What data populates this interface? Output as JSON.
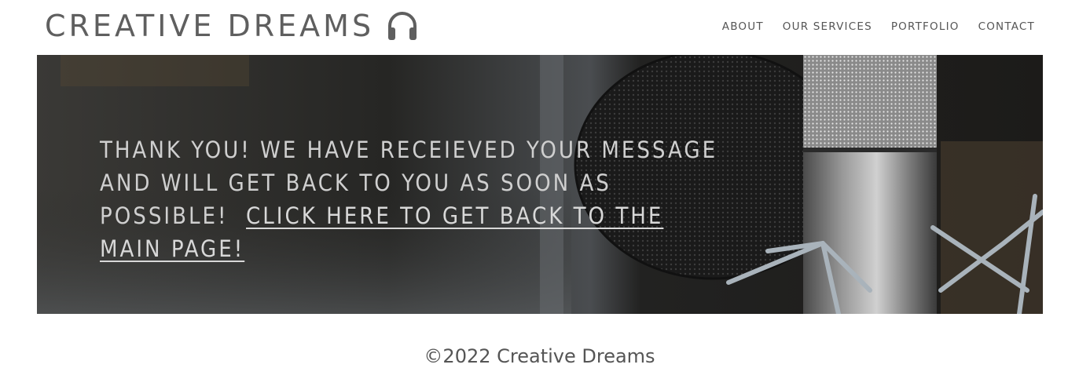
{
  "header": {
    "logo_text": "CREATIVE DREAMS",
    "logo_icon": "headphones-icon"
  },
  "nav": {
    "items": [
      {
        "label": "ABOUT"
      },
      {
        "label": "OUR SERVICES"
      },
      {
        "label": "PORTFOLIO"
      },
      {
        "label": "CONTACT"
      }
    ]
  },
  "hero": {
    "message": "THANK YOU! WE HAVE RECEIEVED YOUR MESSAGE AND WILL GET BACK TO YOU AS SOON AS POSSIBLE!",
    "link_text": "CLICK HERE TO GET BACK TO THE MAIN PAGE!",
    "background": "studio-microphone-photo"
  },
  "footer": {
    "copyright": "©2022 Creative Dreams"
  },
  "colors": {
    "text_gray": "#5f5f5f",
    "hero_text": "#cfcfcf",
    "hero_bg": "#2a2a28"
  }
}
